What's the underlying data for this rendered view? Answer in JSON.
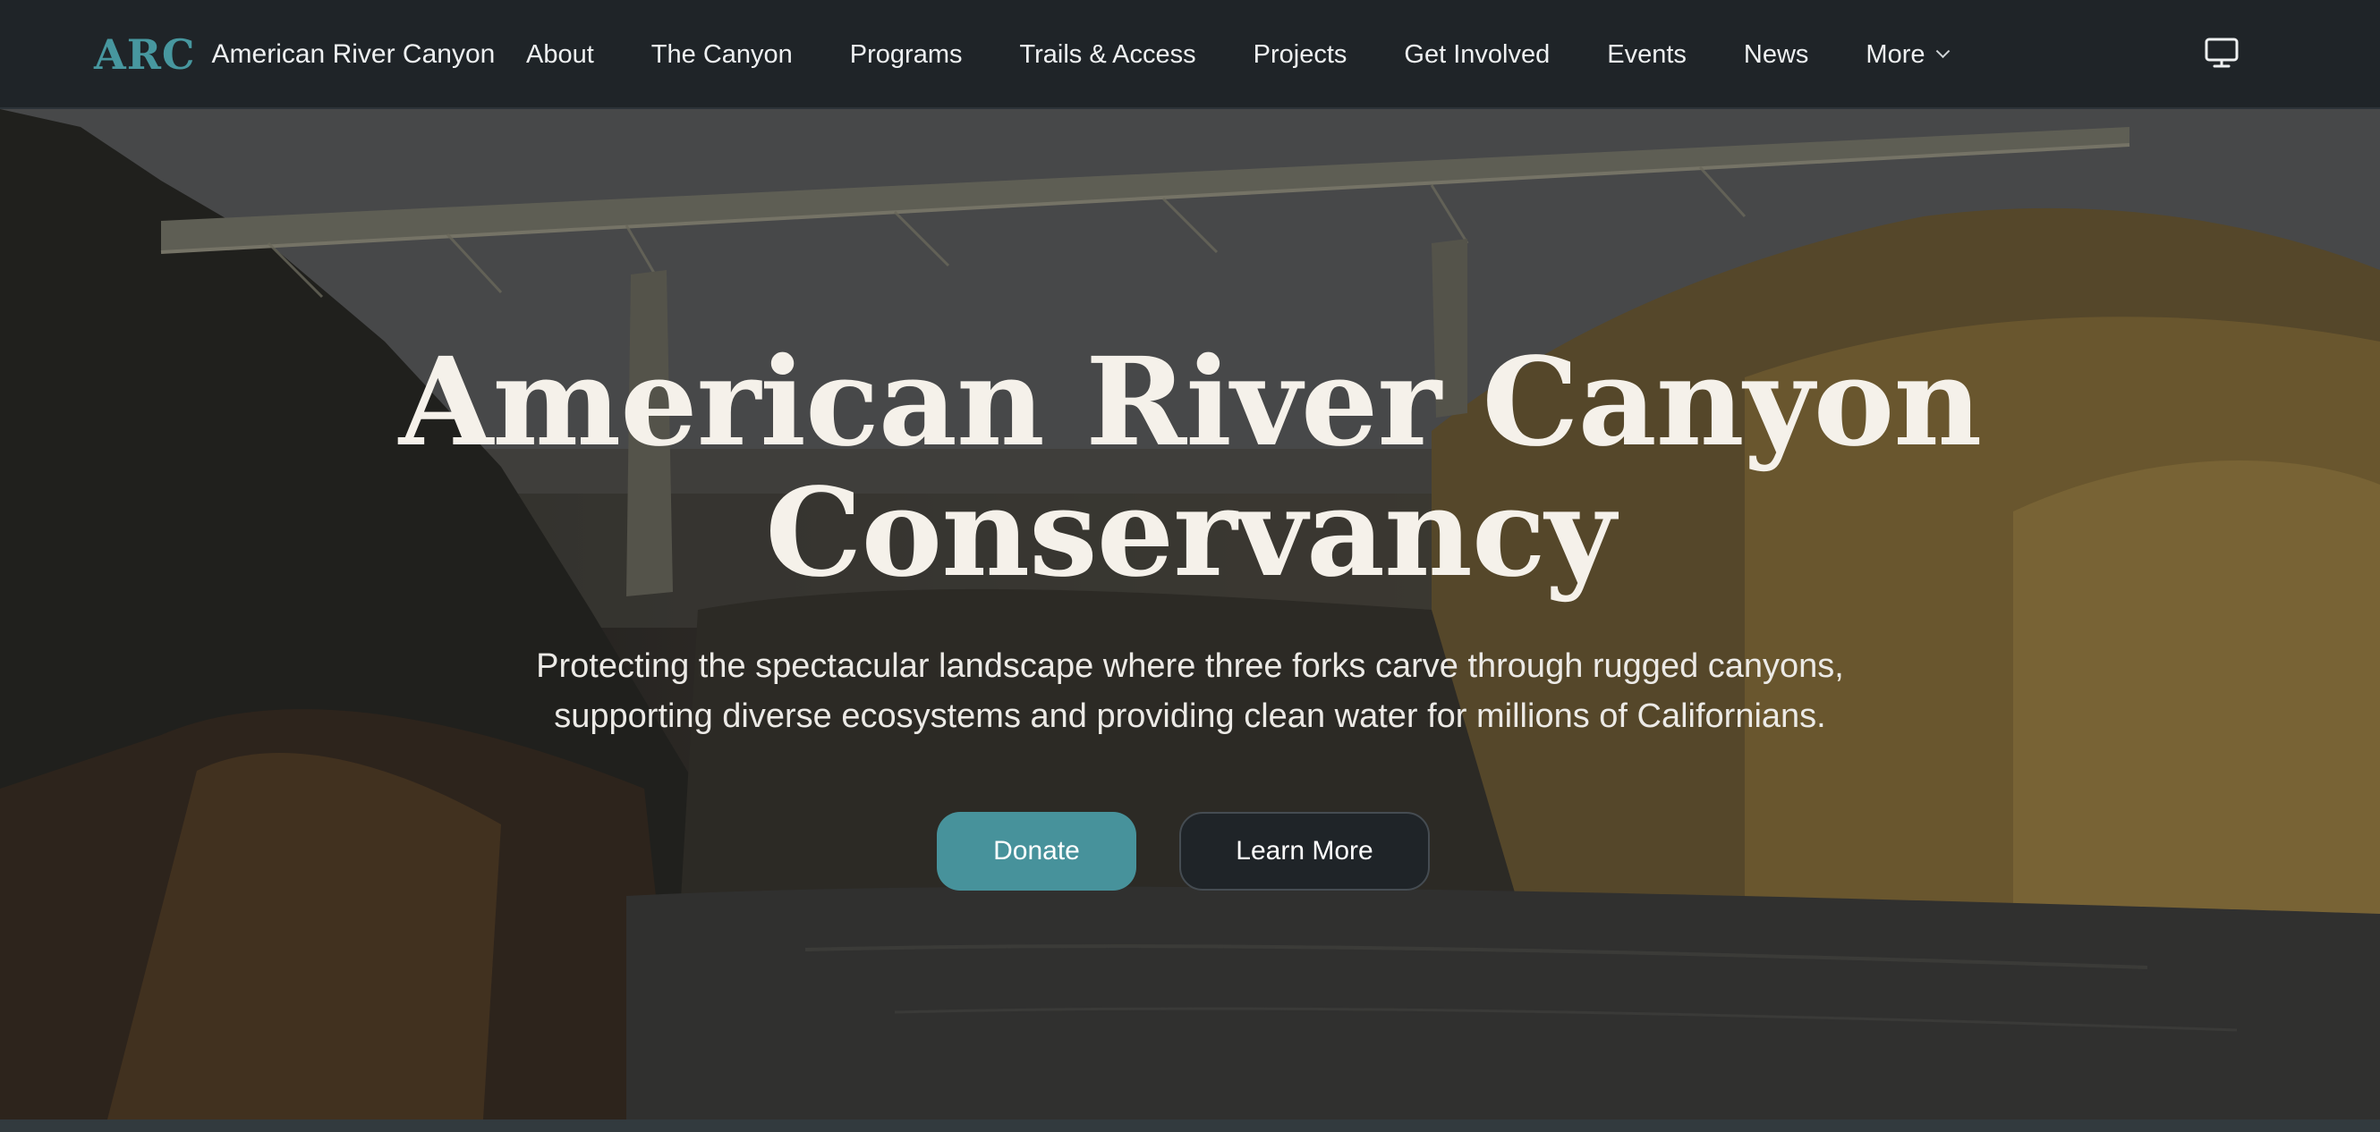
{
  "nav": {
    "logo": "ARC",
    "site_name": "American River Canyon",
    "links": [
      "About",
      "The Canyon",
      "Programs",
      "Trails & Access",
      "Projects",
      "Get Involved",
      "Events",
      "News"
    ],
    "more_label": "More",
    "display_icon": "monitor-icon"
  },
  "hero": {
    "title_line1": "American River Canyon",
    "title_line2": "Conservancy",
    "subtitle_line1": "Protecting the spectacular landscape where three forks carve through rugged canyons,",
    "subtitle_line2": "supporting diverse ecosystems and providing clean water for millions of Californians.",
    "donate_label": "Donate",
    "learn_more_label": "Learn More"
  },
  "colors": {
    "nav_bg": "#1f2428",
    "accent": "#47929b",
    "logo": "#47979f",
    "hero_title": "#f5f1ea"
  }
}
